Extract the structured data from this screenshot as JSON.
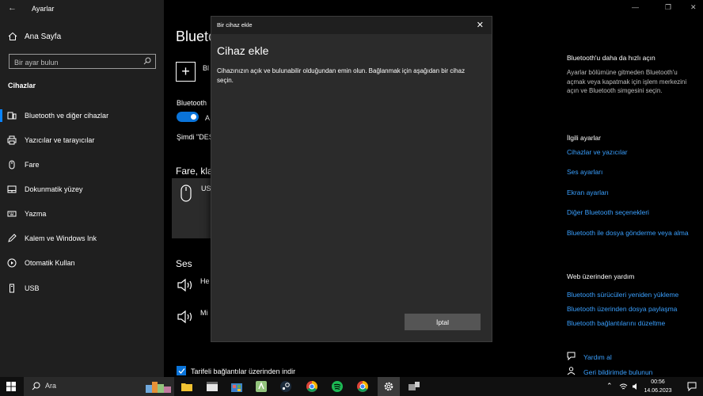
{
  "window": {
    "title": "Ayarlar"
  },
  "nav": {
    "home": "Ana Sayfa",
    "search_placeholder": "Bir ayar bulun",
    "section": "Cihazlar",
    "items": [
      {
        "label": "Bluetooth ve diğer cihazlar",
        "icon": "bluetooth-icon",
        "active": true
      },
      {
        "label": "Yazıcılar ve tarayıcılar",
        "icon": "printer-icon"
      },
      {
        "label": "Fare",
        "icon": "mouse-icon"
      },
      {
        "label": "Dokunmatik yüzey",
        "icon": "touchpad-icon"
      },
      {
        "label": "Yazma",
        "icon": "keyboard-icon"
      },
      {
        "label": "Kalem ve Windows Ink",
        "icon": "pen-icon"
      },
      {
        "label": "Otomatik Kullan",
        "icon": "autoplay-icon"
      },
      {
        "label": "USB",
        "icon": "usb-icon"
      }
    ]
  },
  "main": {
    "title": "Blueto",
    "add_label": "Bl",
    "bt_label": "Bluetooth",
    "toggle_label": "A",
    "now_label": "Şimdi \"DES",
    "mouse_section": "Fare, kla",
    "device_label": "US",
    "sound_section": "Ses",
    "audio1": "He",
    "audio2": "Mi",
    "metered_label": "Tarifeli bağlantılar üzerinden indir"
  },
  "right": {
    "faster_title": "Bluetooth'u daha da hızlı açın",
    "faster_text": "Ayarlar bölümüne gitmeden Bluetooth'u açmak veya kapatmak için işlem merkezini açın ve Bluetooth simgesini seçin.",
    "related_title": "İlgili ayarlar",
    "related_links": [
      "Cihazlar ve yazıcılar",
      "Ses ayarları",
      "Ekran ayarları",
      "Diğer Bluetooth seçenekleri",
      "Bluetooth ile dosya gönderme veya alma"
    ],
    "web_title": "Web üzerinden yardım",
    "web_links": [
      "Bluetooth sürücüleri yeniden yükleme",
      "Bluetooth üzerinden dosya paylaşma",
      "Bluetooth bağlantılarını düzeltme"
    ],
    "help": "Yardım al",
    "feedback": "Geri bildirimde bulunun"
  },
  "dialog": {
    "bar_title": "Bir cihaz ekle",
    "heading": "Cihaz ekle",
    "text": "Cihazınızın açık ve bulunabilir olduğundan emin olun. Bağlanmak için aşağıdan bir cihaz seçin.",
    "cancel": "İptal"
  },
  "taskbar": {
    "search_placeholder": "Ara",
    "time": "00:56",
    "date": "14.06.2023"
  },
  "colors": {
    "accent": "#0a74da",
    "link": "#3aa0ff"
  }
}
